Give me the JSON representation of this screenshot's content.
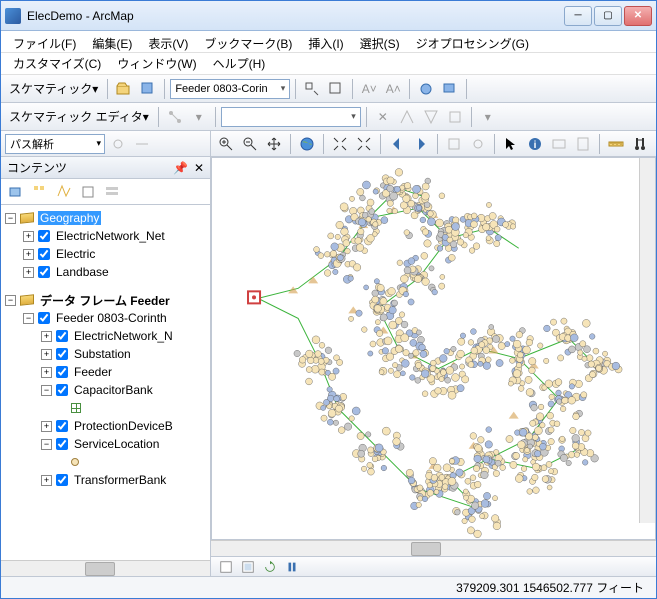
{
  "window": {
    "title": "ElecDemo - ArcMap"
  },
  "menu": {
    "row1": [
      "ファイル(F)",
      "編集(E)",
      "表示(V)",
      "ブックマーク(B)",
      "挿入(I)",
      "選択(S)",
      "ジオプロセシング(G)"
    ],
    "row2": [
      "カスタマイズ(C)",
      "ウィンドウ(W)",
      "ヘルプ(H)"
    ]
  },
  "toolbar1": {
    "schematic_label": "スケマティック",
    "feeder_select": "Feeder 0803-Corin"
  },
  "toolbar2": {
    "editor_label": "スケマティック エディタ"
  },
  "toolbar3": {
    "analysis_label": "パス解析"
  },
  "toc": {
    "title": "コンテンツ",
    "tree": {
      "geography": "Geography",
      "elec_net": "ElectricNetwork_Net",
      "electric": "Electric",
      "landbase": "Landbase",
      "frame_label": "データ フレーム Feeder",
      "feeder_layer": "Feeder 0803-Corinth",
      "sublayers": [
        "ElectricNetwork_N",
        "Substation",
        "Feeder",
        "CapacitorBank",
        "ProtectionDeviceB",
        "ServiceLocation",
        "TransformerBank"
      ]
    }
  },
  "status": {
    "coords": "379209.301 1546502.777 フィート"
  }
}
